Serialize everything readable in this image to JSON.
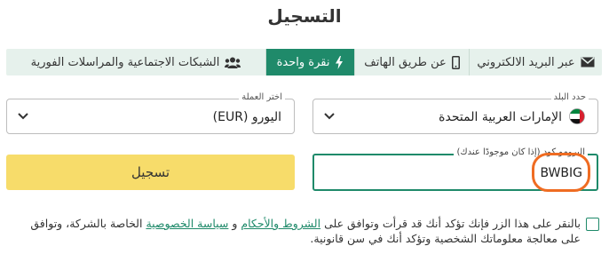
{
  "page": {
    "title": "التسجيل"
  },
  "tabs": [
    {
      "label": "عبر البريد الالكتروني",
      "icon": "envelope-icon",
      "active": false
    },
    {
      "label": "عن طريق الهاتف",
      "icon": "mobile-phone-icon",
      "active": false
    },
    {
      "label": "نقرة واحدة",
      "icon": "lightning-icon",
      "active": true
    },
    {
      "label": "الشبكات الاجتماعية والمراسلات الفورية",
      "icon": "users-icon",
      "active": false
    }
  ],
  "country": {
    "label": "حدد البلد",
    "value": "الإمارات العربية المتحدة",
    "flag": "uae-flag-icon"
  },
  "currency": {
    "label": "اختر العملة",
    "value": "اليورو (EUR)"
  },
  "promo": {
    "label": "البرومو كود (إذا كان موجودًا عندك)",
    "value": "BWBIG"
  },
  "register_button": {
    "label": "تسجيل"
  },
  "terms": {
    "prefix": "بالنقر على هذا الزر فإنك تؤكد أنك قد قرأت وتوافق على ",
    "terms_link": "الشروط والأحكام",
    "and": " و ",
    "privacy_link": "سياسة الخصوصية",
    "suffix": " الخاصة بالشركة، وتوافق على معالجة معلوماتك الشخصية وتؤكد أنك في سن قانونية."
  },
  "colors": {
    "accent": "#1f8a6a",
    "button": "#f7dc6a",
    "highlight": "#ef6c22",
    "tabs_bg": "#e6f1ec"
  }
}
